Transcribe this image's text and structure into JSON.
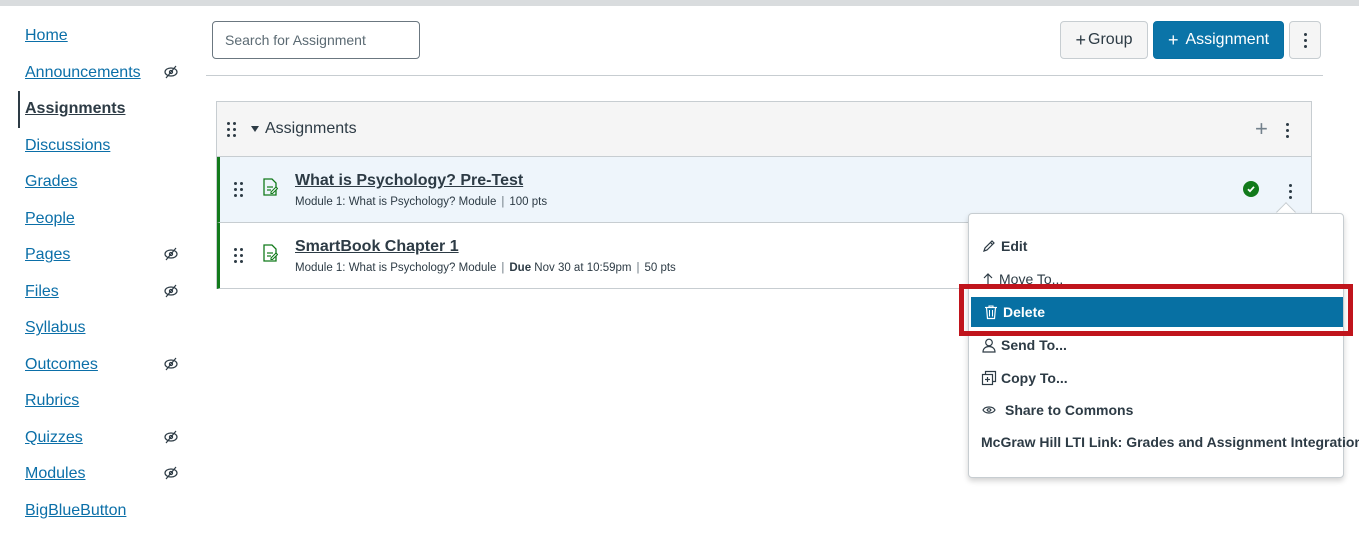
{
  "sidebar": {
    "items": [
      {
        "label": "Home",
        "hidden": false,
        "active": false
      },
      {
        "label": "Announcements",
        "hidden": true,
        "active": false
      },
      {
        "label": "Assignments",
        "hidden": false,
        "active": true
      },
      {
        "label": "Discussions",
        "hidden": false,
        "active": false
      },
      {
        "label": "Grades",
        "hidden": false,
        "active": false
      },
      {
        "label": "People",
        "hidden": false,
        "active": false
      },
      {
        "label": "Pages",
        "hidden": true,
        "active": false
      },
      {
        "label": "Files",
        "hidden": true,
        "active": false
      },
      {
        "label": "Syllabus",
        "hidden": false,
        "active": false
      },
      {
        "label": "Outcomes",
        "hidden": true,
        "active": false
      },
      {
        "label": "Rubrics",
        "hidden": false,
        "active": false
      },
      {
        "label": "Quizzes",
        "hidden": true,
        "active": false
      },
      {
        "label": "Modules",
        "hidden": true,
        "active": false
      },
      {
        "label": "BigBlueButton",
        "hidden": false,
        "active": false
      }
    ]
  },
  "toolbar": {
    "search_placeholder": "Search for Assignment",
    "group_label": "Group",
    "assignment_label": "Assignment"
  },
  "group": {
    "title": "Assignments",
    "assignments": [
      {
        "title": "What is Psychology? Pre-Test",
        "module": "Module 1: What is Psychology? Module",
        "due_label": "",
        "due": "",
        "points": "100 pts",
        "published": true
      },
      {
        "title": "SmartBook Chapter 1",
        "module": "Module 1: What is Psychology? Module",
        "due_label": "Due",
        "due": "Nov 30 at 10:59pm",
        "points": "50 pts",
        "published": false
      }
    ]
  },
  "menu": {
    "items": [
      {
        "label": "Edit",
        "icon": "pencil-icon"
      },
      {
        "label": "Move To...",
        "icon": "arrow-up-icon"
      },
      {
        "label": "Delete",
        "icon": "trash-icon",
        "selected": true
      },
      {
        "label": "Send To...",
        "icon": "user-icon"
      },
      {
        "label": "Copy To...",
        "icon": "copy-icon"
      },
      {
        "label": "Share to Commons",
        "icon": "commons-icon"
      },
      {
        "label": "McGraw Hill LTI Link: Grades and Assignment Integration",
        "icon": ""
      }
    ]
  },
  "colors": {
    "link": "#0b6fa8",
    "primary_button": "#0b74a8",
    "published_green": "#127a1b",
    "selected_menu": "#0770a3",
    "annotation_red": "#c0141c"
  }
}
